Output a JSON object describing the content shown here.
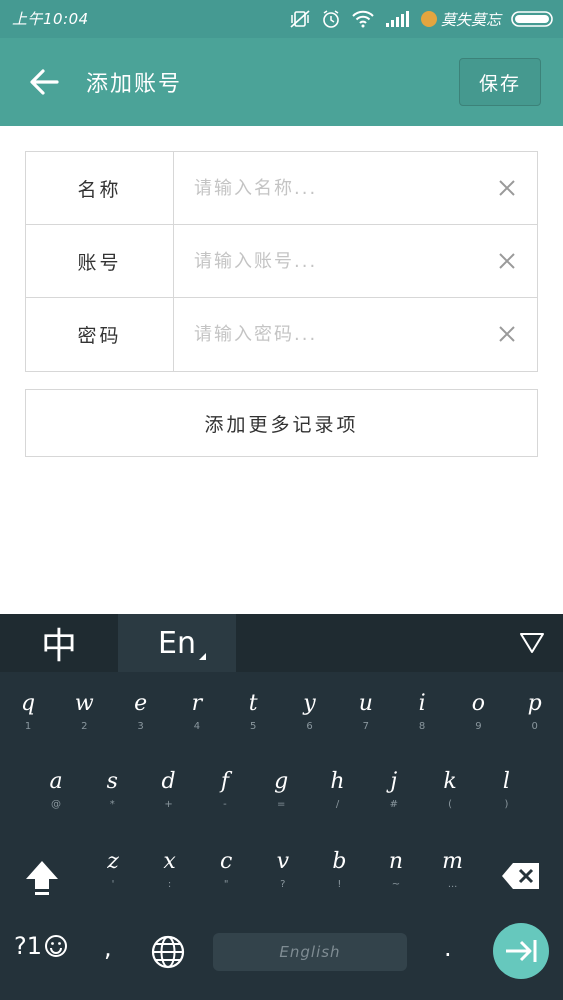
{
  "status_bar": {
    "time": "上午10:04",
    "carrier": "莫失莫忘"
  },
  "app_bar": {
    "title": "添加账号",
    "save_label": "保存"
  },
  "form": {
    "rows": [
      {
        "label": "名称",
        "placeholder": "请输入名称..."
      },
      {
        "label": "账号",
        "placeholder": "请输入账号..."
      },
      {
        "label": "密码",
        "placeholder": "请输入密码..."
      }
    ],
    "add_more_label": "添加更多记录项"
  },
  "keyboard": {
    "tabs": {
      "chinese": "中",
      "english": "En"
    },
    "row1": [
      {
        "key": "q",
        "sub": "1"
      },
      {
        "key": "w",
        "sub": "2"
      },
      {
        "key": "e",
        "sub": "3"
      },
      {
        "key": "r",
        "sub": "4"
      },
      {
        "key": "t",
        "sub": "5"
      },
      {
        "key": "y",
        "sub": "6"
      },
      {
        "key": "u",
        "sub": "7"
      },
      {
        "key": "i",
        "sub": "8"
      },
      {
        "key": "o",
        "sub": "9"
      },
      {
        "key": "p",
        "sub": "0"
      }
    ],
    "row2": [
      {
        "key": "a",
        "sub": "@"
      },
      {
        "key": "s",
        "sub": "*"
      },
      {
        "key": "d",
        "sub": "+"
      },
      {
        "key": "f",
        "sub": "-"
      },
      {
        "key": "g",
        "sub": "="
      },
      {
        "key": "h",
        "sub": "/"
      },
      {
        "key": "j",
        "sub": "#"
      },
      {
        "key": "k",
        "sub": "("
      },
      {
        "key": "l",
        "sub": ")"
      }
    ],
    "row3": [
      {
        "key": "z",
        "sub": "'"
      },
      {
        "key": "x",
        "sub": ":"
      },
      {
        "key": "c",
        "sub": "\""
      },
      {
        "key": "v",
        "sub": "?"
      },
      {
        "key": "b",
        "sub": "!"
      },
      {
        "key": "n",
        "sub": "~"
      },
      {
        "key": "m",
        "sub": "..."
      }
    ],
    "symbols_label": "?1",
    "comma": ",",
    "period": ".",
    "space_label": "English"
  },
  "colors": {
    "primary": "#4ba398",
    "status_bar": "#459a92",
    "keyboard_bg": "#24323a",
    "enter_key": "#66c8bd"
  }
}
